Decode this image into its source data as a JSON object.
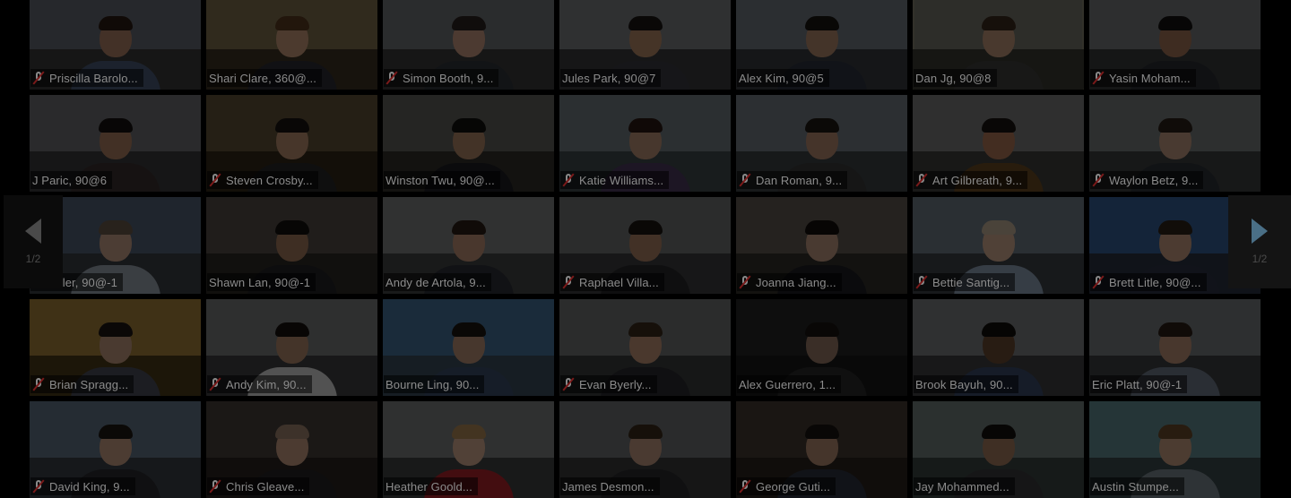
{
  "gallery": {
    "page_indicator_left": "1/2",
    "page_indicator_right": "1/2",
    "participants": [
      {
        "name": "Priscilla Barolo...",
        "muted": true,
        "wall": "#6f7480",
        "floor": "#3c3c3c",
        "skin": "#b08068",
        "hair": "#2a1c14",
        "shirt": "#4a5b78"
      },
      {
        "name": "Shari Clare, 360@...",
        "muted": false,
        "wall": "#8c7a55",
        "floor": "#3d3322",
        "skin": "#c79a7a",
        "hair": "#5a3a20",
        "shirt": "#2f2f35"
      },
      {
        "name": "Simon Booth, 9...",
        "muted": true,
        "wall": "#7c7f84",
        "floor": "#3a3a3c",
        "skin": "#c89a80",
        "hair": "#2a2220",
        "shirt": "#30353c"
      },
      {
        "name": "Jules Park, 90@7",
        "muted": false,
        "wall": "#8a8c90",
        "floor": "#3b3b3e",
        "skin": "#b58868",
        "hair": "#1b1714",
        "shirt": "#3c3c42"
      },
      {
        "name": "Alex Kim, 90@5",
        "muted": false,
        "wall": "#7d8690",
        "floor": "#383c40",
        "skin": "#b3896d",
        "hair": "#191512",
        "shirt": "#2d3340"
      },
      {
        "name": "Dan Jg, 90@8",
        "muted": false,
        "wall": "#858378",
        "floor": "#3c3a33",
        "skin": "#bf977a",
        "hair": "#3a2a1d",
        "shirt": "#41413e",
        "active": true
      },
      {
        "name": "Yasin Moham...",
        "muted": true,
        "wall": "#83868a",
        "floor": "#393a3c",
        "skin": "#a27558",
        "hair": "#141210",
        "shirt": "#2b2d32"
      },
      {
        "name": "J Paric, 90@6",
        "muted": false,
        "wall": "#7a7c80",
        "floor": "#3c3c3e",
        "skin": "#ad7e62",
        "hair": "#161210",
        "shirt": "#3a3030"
      },
      {
        "name": "Steven Crosby...",
        "muted": true,
        "wall": "#6c5a3e",
        "floor": "#33291a",
        "skin": "#ba8e70",
        "hair": "#181412",
        "shirt": "#282828"
      },
      {
        "name": "Winston Twu, 90@...",
        "muted": false,
        "wall": "#6e6c66",
        "floor": "#33312c",
        "skin": "#b08668",
        "hair": "#12100e",
        "shirt": "#1e1e22"
      },
      {
        "name": "Katie Williams...",
        "muted": true,
        "wall": "#7e8a8e",
        "floor": "#404a4c",
        "skin": "#bc9078",
        "hair": "#2a1a14",
        "shirt": "#4c3a60"
      },
      {
        "name": "Dan Roman, 9...",
        "muted": true,
        "wall": "#818a92",
        "floor": "#3e4246",
        "skin": "#b68a70",
        "hair": "#1e1814",
        "shirt": "#3a3a3a"
      },
      {
        "name": "Art Gilbreath, 9...",
        "muted": true,
        "wall": "#8a8a88",
        "floor": "#3f3f3d",
        "skin": "#b07858",
        "hair": "#1a1410",
        "shirt": "#6a4a22"
      },
      {
        "name": "Waylon Betz, 9...",
        "muted": true,
        "wall": "#84888a",
        "floor": "#3e3f40",
        "skin": "#c09a80",
        "hair": "#2a2018",
        "shirt": "#2f3238"
      },
      {
        "name": "J Sadler, 90@-1",
        "muted": false,
        "wall": "#5a6c84",
        "floor": "#3a3f46",
        "skin": "#c9a08a",
        "hair": "#6a5a4a",
        "shirt": "#9aa2ae"
      },
      {
        "name": "Shawn Lan, 90@-1",
        "muted": false,
        "wall": "#5f574f",
        "floor": "#2f2b27",
        "skin": "#a47a5c",
        "hair": "#14110f",
        "shirt": "#222226"
      },
      {
        "name": "Andy de Artola, 9...",
        "muted": false,
        "wall": "#8d8f90",
        "floor": "#434445",
        "skin": "#bf9278",
        "hair": "#2a1e16",
        "shirt": "#2f3138"
      },
      {
        "name": "Raphael Villa...",
        "muted": true,
        "wall": "#7d7f80",
        "floor": "#3d3e3f",
        "skin": "#ad8064",
        "hair": "#1b1511",
        "shirt": "#28282c"
      },
      {
        "name": "Joanna Jiang...",
        "muted": true,
        "wall": "#6e655a",
        "floor": "#32302c",
        "skin": "#c09a80",
        "hair": "#140f0c",
        "shirt": "#1e1e22"
      },
      {
        "name": "Bettie Santig...",
        "muted": true,
        "wall": "#7b8a96",
        "floor": "#3d4248",
        "skin": "#d2ac92",
        "hair": "#c2b09a",
        "shirt": "#8fa0b6"
      },
      {
        "name": "Brett Litle, 90@...",
        "muted": true,
        "wall": "#3c6aa6",
        "floor": "#2c3442",
        "skin": "#c79c80",
        "hair": "#2e2218",
        "shirt": "#2e3446"
      },
      {
        "name": "Brian Spragg...",
        "muted": true,
        "wall": "#b89040",
        "floor": "#4a3a1a",
        "skin": "#c39a7e",
        "hair": "#1e1713",
        "shirt": "#4a4e5a"
      },
      {
        "name": "Andy Kim, 90...",
        "muted": true,
        "wall": "#86888a",
        "floor": "#3f4042",
        "skin": "#b48a6c",
        "hair": "#15110e",
        "shirt": "#d7d7d7"
      },
      {
        "name": "Bourne Ling, 90...",
        "muted": false,
        "wall": "#4d7ea8",
        "floor": "#3c4e5e",
        "skin": "#ba9076",
        "hair": "#1c1612",
        "shirt": "#3c4e6a"
      },
      {
        "name": "Evan Byerly...",
        "muted": true,
        "wall": "#7d8082",
        "floor": "#3c3d3e",
        "skin": "#c29478",
        "hair": "#3a2a1c",
        "shirt": "#2b2c30"
      },
      {
        "name": "Alex Guerrero, 1...",
        "muted": false,
        "wall": "#2b2b2b",
        "floor": "#191919",
        "skin": "#9a7a66",
        "hair": "#1a1410",
        "shirt": "#2a2a2a"
      },
      {
        "name": "Brook Bayuh, 90...",
        "muted": false,
        "wall": "#8a8c8e",
        "floor": "#3f4042",
        "skin": "#6b4a32",
        "hair": "#120e0b",
        "shirt": "#3a4a6a"
      },
      {
        "name": "Eric Platt, 90@-1",
        "muted": false,
        "wall": "#84888c",
        "floor": "#3e4042",
        "skin": "#bd9276",
        "hair": "#2a1e16",
        "shirt": "#6e7a8a"
      },
      {
        "name": "David King, 9...",
        "muted": true,
        "wall": "#6d7f96",
        "floor": "#3a4048",
        "skin": "#c89e84",
        "hair": "#1e1813",
        "shirt": "#2c2c30"
      },
      {
        "name": "Chris Gleave...",
        "muted": true,
        "wall": "#4f4640",
        "floor": "#2a2421",
        "skin": "#c79c82",
        "hair": "#a08470",
        "shirt": "#262226"
      },
      {
        "name": "Heather Goold...",
        "muted": false,
        "wall": "#8a8c8c",
        "floor": "#404242",
        "skin": "#d4ac92",
        "hair": "#b08a58",
        "shirt": "#b0242a"
      },
      {
        "name": "James Desmon...",
        "muted": false,
        "wall": "#7c7e80",
        "floor": "#3a3b3c",
        "skin": "#c29a80",
        "hair": "#3a2a1c",
        "shirt": "#2a2b2f"
      },
      {
        "name": "George Guti...",
        "muted": true,
        "wall": "#4e4238",
        "floor": "#2b241e",
        "skin": "#b58c72",
        "hair": "#1a1410",
        "shirt": "#2e3240"
      },
      {
        "name": "Jay Mohammed...",
        "muted": false,
        "wall": "#7e8c88",
        "floor": "#3c4442",
        "skin": "#a77c60",
        "hair": "#14100e",
        "shirt": "#3a3a3e"
      },
      {
        "name": "Austin Stumpe...",
        "muted": false,
        "wall": "#6c9aa0",
        "floor": "#3c4a4c",
        "skin": "#c99e82",
        "hair": "#6a4a2a",
        "shirt": "#7a868e"
      }
    ]
  }
}
